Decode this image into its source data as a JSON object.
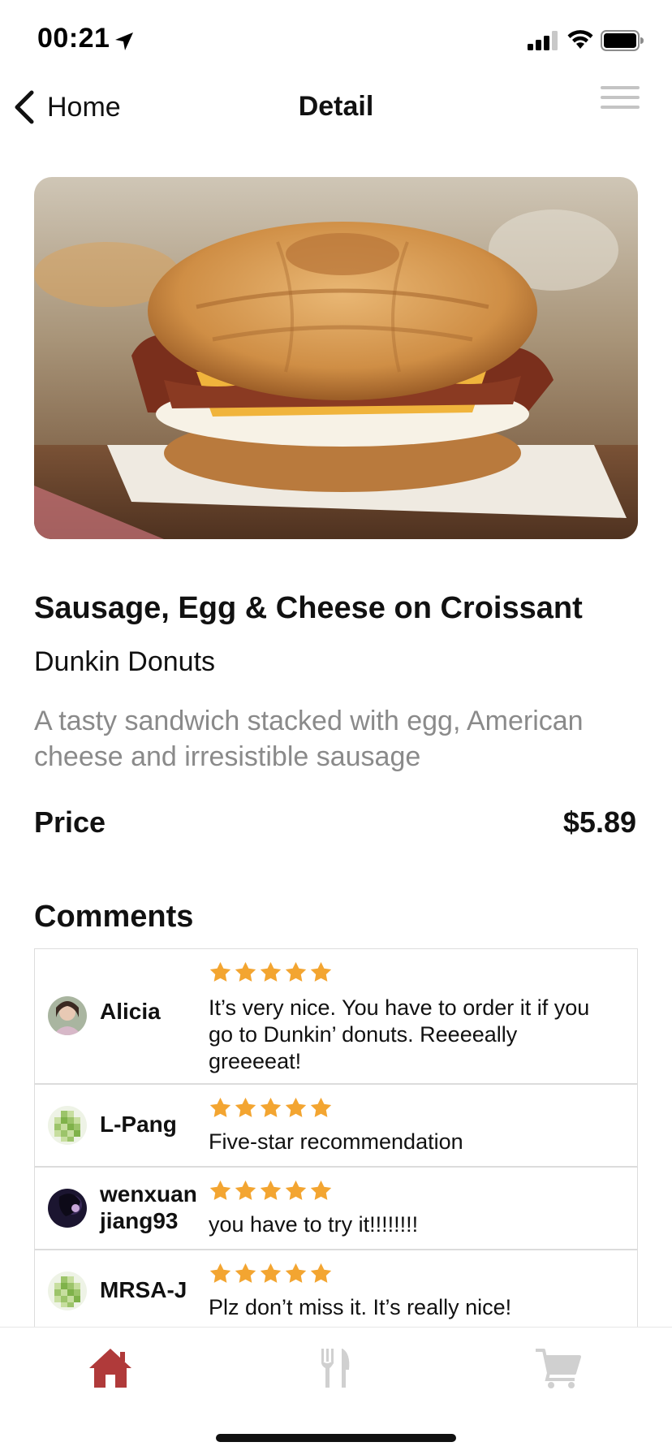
{
  "status_bar": {
    "time": "00:21",
    "icons": [
      "location-arrow-icon",
      "signal-bars-icon",
      "wifi-icon",
      "battery-icon"
    ]
  },
  "nav": {
    "back_label": "Home",
    "title": "Detail",
    "menu_icon": "hamburger-menu-icon"
  },
  "product": {
    "image": "croissant-sandwich-photo",
    "name": "Sausage, Egg & Cheese on Croissant",
    "brand": "Dunkin Donuts",
    "description": "A tasty sandwich stacked with egg, American cheese and irresistible sausage",
    "price_label": "Price",
    "price": "$5.89"
  },
  "comments": {
    "heading": "Comments",
    "items": [
      {
        "user": "Alicia",
        "rating": 5,
        "text": "It’s very nice. You have to order it if you go to Dunkin’ donuts. Reeeeally greeeeat!"
      },
      {
        "user": "L-Pang",
        "rating": 5,
        "text": "Five-star recommendation"
      },
      {
        "user": "wenxuan jiang93",
        "rating": 5,
        "text": "you have to try it!!!!!!!!"
      },
      {
        "user": "MRSA-J",
        "rating": 5,
        "text": "Plz don’t miss it. It’s really nice!"
      }
    ]
  },
  "tab_bar": {
    "tabs": [
      {
        "icon": "home-icon",
        "active": true
      },
      {
        "icon": "fork-knife-icon",
        "active": false
      },
      {
        "icon": "cart-icon",
        "active": false
      }
    ]
  },
  "colors": {
    "accent_red": "#b03a3a",
    "star_orange": "#f3a531",
    "inactive_icon": "#d0d0d0",
    "description_gray": "#8a8a8a"
  }
}
